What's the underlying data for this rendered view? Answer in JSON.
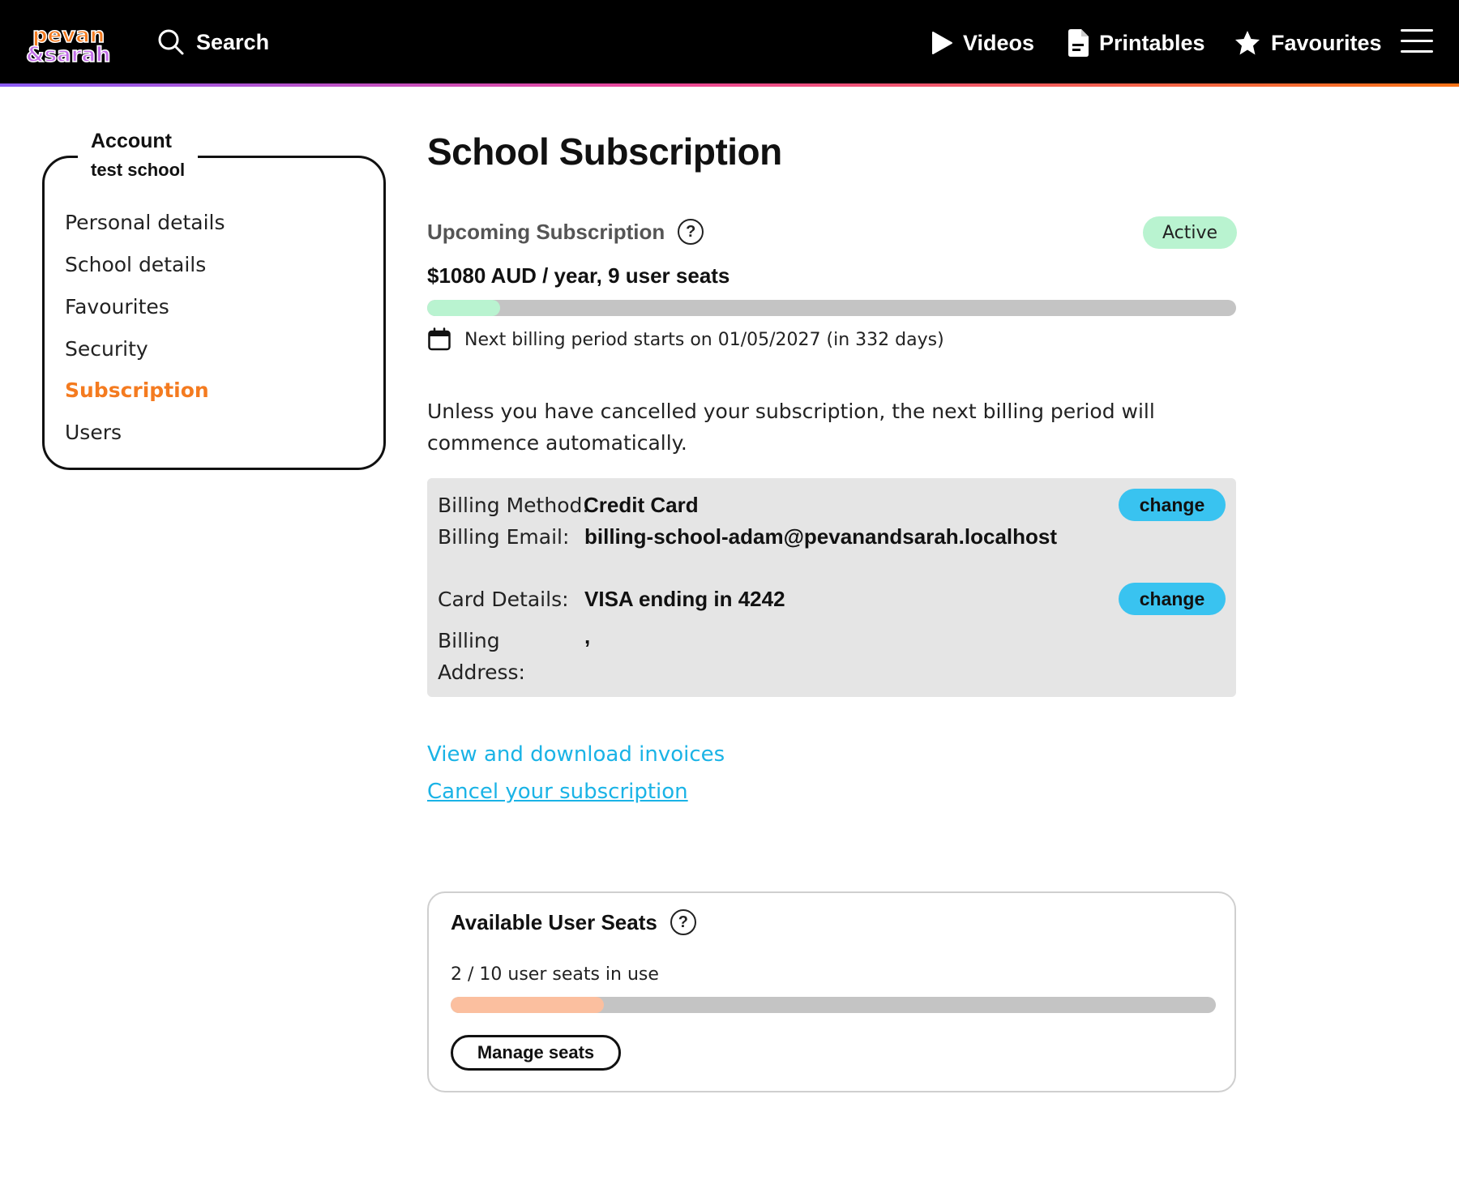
{
  "header": {
    "logo_icon": "pevan-sarah-logo",
    "search_label": "Search",
    "nav": {
      "videos": "Videos",
      "printables": "Printables",
      "favourites": "Favourites"
    }
  },
  "sidebar": {
    "heading": "Account",
    "account_name": "test school",
    "items": [
      {
        "label": "Personal details",
        "active": false
      },
      {
        "label": "School details",
        "active": false
      },
      {
        "label": "Favourites",
        "active": false
      },
      {
        "label": "Security",
        "active": false
      },
      {
        "label": "Subscription",
        "active": true
      },
      {
        "label": "Users",
        "active": false
      }
    ]
  },
  "main": {
    "title": "School Subscription",
    "subscription": {
      "heading": "Upcoming Subscription",
      "status": "Active",
      "price": "$1080 AUD / year, 9 user seats",
      "progress_fraction": 0.09,
      "next_billing": "Next billing period starts on 01/05/2027 (in 332 days)"
    },
    "notice": "Unless you have cancelled your subscription, the next billing period will commence automatically.",
    "billing": {
      "method_label": "Billing Method:",
      "method_value": "Credit Card",
      "email_label": "Billing Email:",
      "email_value": "billing-school-adam@pevanandsarah.localhost",
      "card_label": "Card Details:",
      "card_value": "VISA ending in 4242",
      "address_label_1": "Billing",
      "address_label_2": "Address:",
      "address_value": ",",
      "change_label": "change"
    },
    "links": {
      "invoices": "View and download invoices",
      "cancel": "Cancel your subscription"
    },
    "seats": {
      "title": "Available User Seats",
      "usage": "2 / 10 user seats in use",
      "used": 2,
      "total": 10,
      "manage_label": "Manage seats"
    }
  },
  "colors": {
    "accent_orange": "#f47b20",
    "link_blue": "#1ab3e6",
    "button_blue": "#39c3f0",
    "active_green": "#b9f3d0",
    "seats_fill": "#fbbf9f"
  }
}
